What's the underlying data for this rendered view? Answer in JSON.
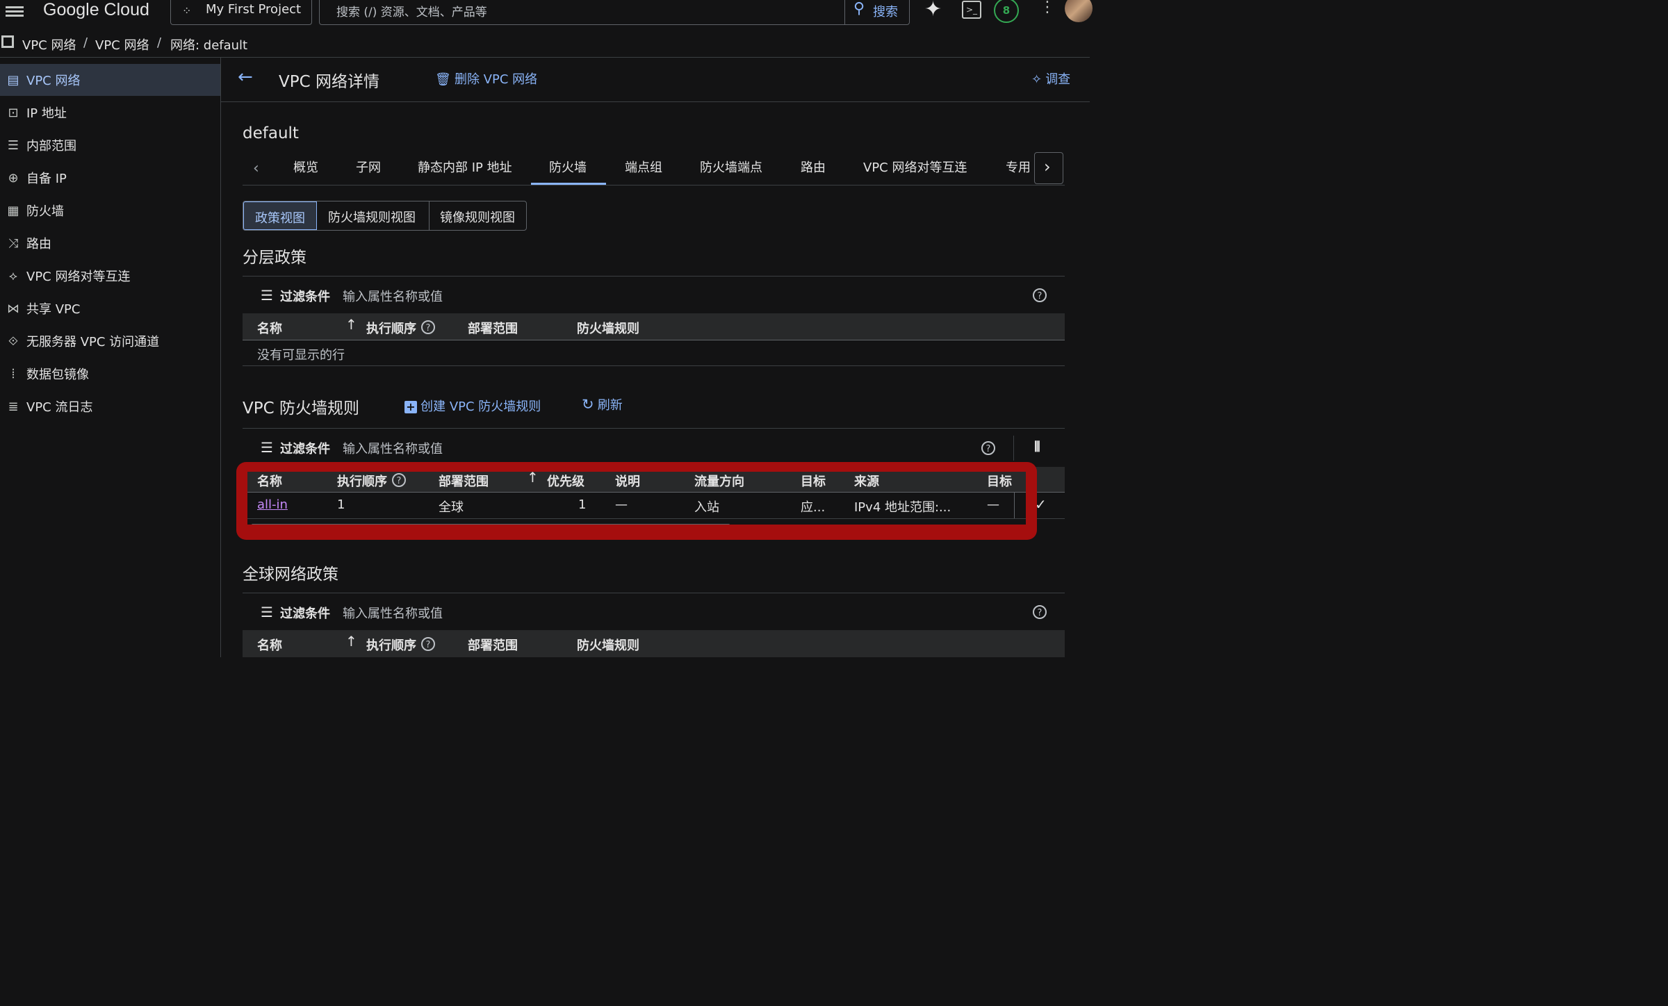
{
  "topbar": {
    "logo": "Google Cloud",
    "project": "My First Project",
    "search_placeholder": "搜索 (/) 资源、文档、产品等",
    "search_button": "搜索",
    "badge": "8"
  },
  "breadcrumb": [
    "VPC 网络",
    "/",
    "VPC 网络",
    "/",
    "网络: default"
  ],
  "sidebar": {
    "items": [
      {
        "label": "VPC 网络",
        "icon": "vpc-network-icon"
      },
      {
        "label": "IP 地址",
        "icon": "ip-address-icon"
      },
      {
        "label": "内部范围",
        "icon": "internal-range-icon"
      },
      {
        "label": "自备 IP",
        "icon": "globe-icon"
      },
      {
        "label": "防火墙",
        "icon": "firewall-icon"
      },
      {
        "label": "路由",
        "icon": "route-icon"
      },
      {
        "label": "VPC 网络对等互连",
        "icon": "peering-icon"
      },
      {
        "label": "共享 VPC",
        "icon": "shared-vpc-icon"
      },
      {
        "label": "无服务器 VPC 访问通道",
        "icon": "serverless-icon"
      },
      {
        "label": "数据包镜像",
        "icon": "packet-mirror-icon"
      },
      {
        "label": "VPC 流日志",
        "icon": "flow-log-icon"
      }
    ]
  },
  "header": {
    "title": "VPC 网络详情",
    "delete": "删除 VPC 网络",
    "investigate": "调查"
  },
  "network_name": "default",
  "tabs": [
    "概览",
    "子网",
    "静态内部 IP 地址",
    "防火墙",
    "端点组",
    "防火墙端点",
    "路由",
    "VPC 网络对等互连",
    "专用"
  ],
  "views": [
    "政策视图",
    "防火墙规则视图",
    "镜像规则视图"
  ],
  "hier": {
    "title": "分层政策",
    "filter_label": "过滤条件",
    "filter_placeholder": "输入属性名称或值",
    "cols": [
      "名称",
      "执行顺序",
      "部署范围",
      "防火墙规则"
    ],
    "empty": "没有可显示的行"
  },
  "vpcfw": {
    "title": "VPC 防火墙规则",
    "create": "创建 VPC 防火墙规则",
    "refresh": "刷新",
    "filter_label": "过滤条件",
    "filter_placeholder": "输入属性名称或值",
    "cols": [
      "名称",
      "执行顺序",
      "部署范围",
      "优先级",
      "说明",
      "流量方向",
      "目标",
      "来源",
      "目标"
    ],
    "row": {
      "name": "all-in",
      "order": "1",
      "scope": "全球",
      "priority": "1",
      "desc": "—",
      "direction": "入站",
      "target": "应...",
      "source": "IPv4 地址范围:...",
      "dest": "—"
    }
  },
  "global": {
    "title": "全球网络政策",
    "filter_label": "过滤条件",
    "filter_placeholder": "输入属性名称或值",
    "cols": [
      "名称",
      "执行顺序",
      "部署范围",
      "防火墙规则"
    ]
  },
  "colors": {
    "background": "#131314",
    "accent": "#8ab4f8",
    "highlight_box": "#a50e0e",
    "badge_green": "#34a853"
  }
}
